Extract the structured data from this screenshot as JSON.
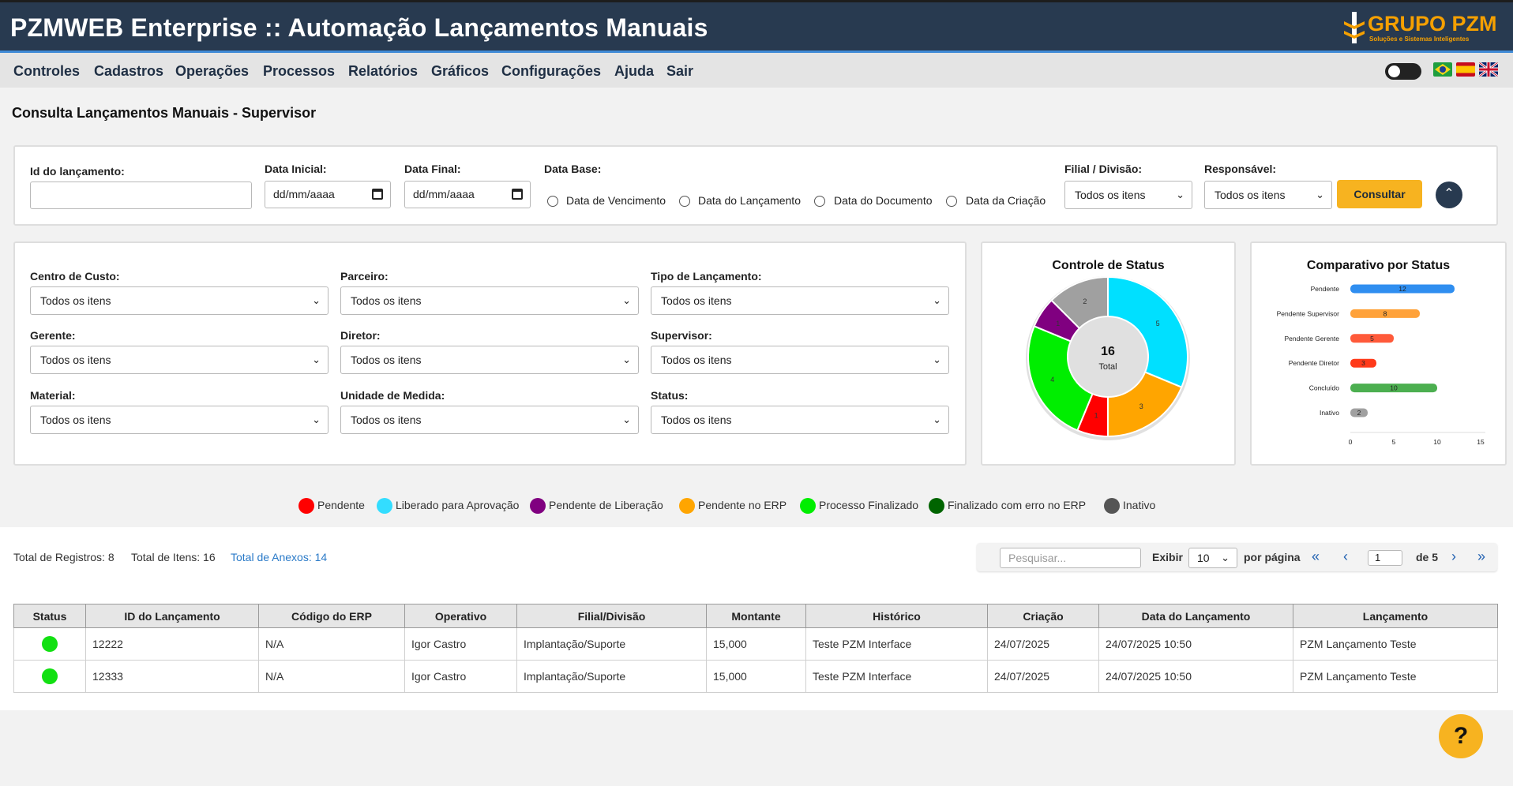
{
  "header": {
    "title": "PZMWEB Enterprise :: Automação Lançamentos Manuais",
    "logo_text": "GRUPO PZM",
    "logo_sub": "Soluções e Sistemas Inteligentes"
  },
  "menu": [
    "Controles",
    "Cadastros",
    "Operações",
    "Processos",
    "Relatórios",
    "Gráficos",
    "Configurações",
    "Ajuda",
    "Sair"
  ],
  "page_title": "Consulta Lançamentos Manuais - Supervisor",
  "filters_top": {
    "id_label": "Id do lançamento:",
    "id_value": "",
    "data_inicial_label": "Data Inicial:",
    "data_inicial_value": "dd/mm/aaaa",
    "data_final_label": "Data Final:",
    "data_final_value": "dd/mm/aaaa",
    "data_base_label": "Data Base:",
    "data_base_options": [
      "Data de Vencimento",
      "Data do Lançamento",
      "Data do Documento",
      "Data da Criação"
    ],
    "filial_label": "Filial / Divisão:",
    "filial_value": "Todos os itens",
    "responsavel_label": "Responsável:",
    "responsavel_value": "Todos os itens",
    "consultar_label": "Consultar"
  },
  "filters_grid": [
    {
      "label": "Centro de Custo:",
      "value": "Todos os itens"
    },
    {
      "label": "Parceiro:",
      "value": "Todos os itens"
    },
    {
      "label": "Tipo de Lançamento:",
      "value": "Todos os itens"
    },
    {
      "label": "Gerente:",
      "value": "Todos os itens"
    },
    {
      "label": "Diretor:",
      "value": "Todos os itens"
    },
    {
      "label": "Supervisor:",
      "value": "Todos os itens"
    },
    {
      "label": "Material:",
      "value": "Todos os itens"
    },
    {
      "label": "Unidade de Medida:",
      "value": "Todos os itens"
    },
    {
      "label": "Status:",
      "value": "Todos os itens"
    }
  ],
  "chart_data": [
    {
      "type": "pie",
      "title": "Controle de Status",
      "center_value": "16",
      "center_label": "Total",
      "slices": [
        {
          "value": 5,
          "color": "#00e0ff"
        },
        {
          "value": 3,
          "color": "#ffa500"
        },
        {
          "value": 1,
          "color": "#ff0000"
        },
        {
          "value": 4,
          "color": "#00ee00"
        },
        {
          "value": 1,
          "color": "#800080"
        },
        {
          "value": 2,
          "color": "#a0a0a0"
        }
      ]
    },
    {
      "type": "bar",
      "title": "Comparativo por Status",
      "categories": [
        "Pendente",
        "Pendente Supervisor",
        "Pendente Gerente",
        "Pendente Diretor",
        "Concluído",
        "Inativo"
      ],
      "values": [
        12,
        8,
        5,
        3,
        10,
        2
      ],
      "colors": [
        "#2f8ef0",
        "#ffa23a",
        "#ff5a3a",
        "#ff3a1a",
        "#4caf50",
        "#a0a0a0"
      ],
      "xlim": [
        0,
        15
      ],
      "xticks": [
        "0",
        "5",
        "10",
        "15"
      ]
    }
  ],
  "legend": [
    {
      "label": "Pendente",
      "color": "#ff0000"
    },
    {
      "label": "Liberado para Aprovação",
      "color": "#33ddff"
    },
    {
      "label": "Pendente de Liberação",
      "color": "#800080"
    },
    {
      "label": "Pendente no ERP",
      "color": "#ffa500"
    },
    {
      "label": "Processo Finalizado",
      "color": "#00ee00"
    },
    {
      "label": "Finalizado com erro no ERP",
      "color": "#006400"
    },
    {
      "label": "Inativo",
      "color": "#555555"
    }
  ],
  "stats": {
    "registros": "Total de Registros: 8",
    "itens": "Total de Itens: 16",
    "anexos": "Total de Anexos: 14"
  },
  "pager": {
    "search_placeholder": "Pesquisar...",
    "exibir_label": "Exibir",
    "per_page": "10",
    "por_pagina": "por página",
    "page": "1",
    "de_label": "de 5"
  },
  "table": {
    "headers": [
      "Status",
      "ID do Lançamento",
      "Código do ERP",
      "Operativo",
      "Filial/Divisão",
      "Montante",
      "Histórico",
      "Criação",
      "Data do Lançamento",
      "Lançamento"
    ],
    "rows": [
      {
        "status_color": "#12e012",
        "cells": [
          "12222",
          "N/A",
          "Igor Castro",
          "Implantação/Suporte",
          "15,000",
          "Teste PZM Interface",
          "24/07/2025",
          "24/07/2025 10:50",
          "PZM Lançamento Teste"
        ]
      },
      {
        "status_color": "#12e012",
        "cells": [
          "12333",
          "N/A",
          "Igor Castro",
          "Implantação/Suporte",
          "15,000",
          "Teste PZM Interface",
          "24/07/2025",
          "24/07/2025 10:50",
          "PZM Lançamento Teste"
        ]
      }
    ]
  },
  "help_label": "?"
}
